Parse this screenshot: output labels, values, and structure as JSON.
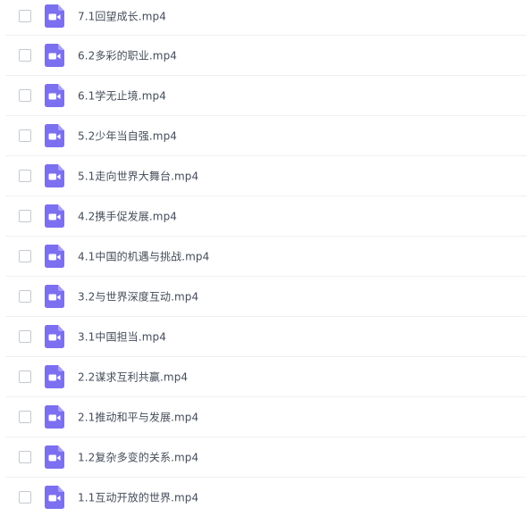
{
  "icon": {
    "name": "video-file-icon",
    "color": "#7c6ff0",
    "glyph_color": "#ffffff"
  },
  "files": [
    {
      "name": "7.1回望成长.mp4"
    },
    {
      "name": "6.2多彩的职业.mp4"
    },
    {
      "name": "6.1学无止境.mp4"
    },
    {
      "name": "5.2少年当自强.mp4"
    },
    {
      "name": "5.1走向世界大舞台.mp4"
    },
    {
      "name": "4.2携手促发展.mp4"
    },
    {
      "name": "4.1中国的机遇与挑战.mp4"
    },
    {
      "name": "3.2与世界深度互动.mp4"
    },
    {
      "name": "3.1中国担当.mp4"
    },
    {
      "name": "2.2谋求互利共赢.mp4"
    },
    {
      "name": "2.1推动和平与发展.mp4"
    },
    {
      "name": "1.2复杂多变的关系.mp4"
    },
    {
      "name": "1.1互动开放的世界.mp4"
    }
  ]
}
